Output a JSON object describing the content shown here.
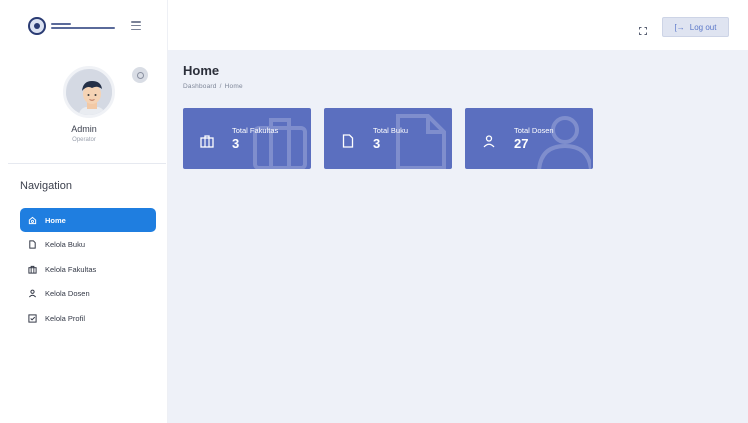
{
  "sidebar": {
    "profile": {
      "name": "Admin",
      "role": "Operator"
    },
    "nav_title": "Navigation",
    "items": [
      {
        "label": "Home",
        "icon": "home-icon",
        "active": true
      },
      {
        "label": "Kelola Buku",
        "icon": "file-icon",
        "active": false
      },
      {
        "label": "Kelola Fakultas",
        "icon": "briefcase-icon",
        "active": false
      },
      {
        "label": "Kelola Dosen",
        "icon": "user-icon",
        "active": false
      },
      {
        "label": "Kelola Profil",
        "icon": "edit-icon",
        "active": false
      }
    ]
  },
  "topbar": {
    "logout_label": "Log out"
  },
  "page": {
    "title": "Home",
    "breadcrumb": [
      "Dashboard",
      "Home"
    ]
  },
  "cards": [
    {
      "label": "Total Fakultas",
      "value": "3",
      "icon": "briefcase-icon"
    },
    {
      "label": "Total Buku",
      "value": "3",
      "icon": "file-icon"
    },
    {
      "label": "Total Dosen",
      "value": "27",
      "icon": "user-icon"
    }
  ],
  "colors": {
    "primary": "#1f7ee0",
    "card": "#5b6fbf",
    "background": "#eef1f8"
  }
}
